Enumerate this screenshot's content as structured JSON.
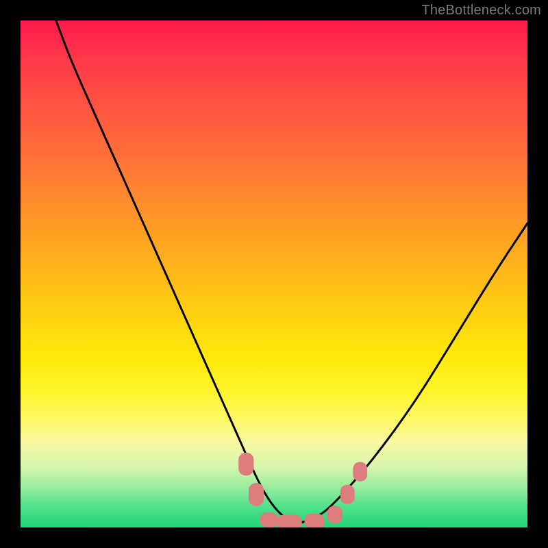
{
  "watermark": "TheBottleneck.com",
  "chart_data": {
    "type": "line",
    "title": "",
    "xlabel": "",
    "ylabel": "",
    "xlim": [
      0,
      100
    ],
    "ylim": [
      0,
      100
    ],
    "grid": false,
    "legend": false,
    "background_gradient": {
      "top": "#ff1a4d",
      "mid": "#ffe80a",
      "bottom": "#22d47a"
    },
    "series": [
      {
        "name": "bottleneck-curve",
        "color": "#000000",
        "x": [
          7,
          10,
          14,
          18,
          22,
          26,
          30,
          34,
          38,
          42,
          46,
          48,
          50,
          52,
          54,
          56,
          58,
          60,
          64,
          70,
          78,
          86,
          94,
          100
        ],
        "y": [
          100,
          92,
          83,
          74,
          65,
          56,
          47,
          38,
          29,
          20,
          11,
          7,
          4,
          2,
          1,
          1,
          2,
          3,
          7,
          14,
          25,
          38,
          51,
          60
        ]
      }
    ],
    "markers": {
      "name": "highlight-points",
      "shape": "rounded-rect",
      "color": "#de7d7d",
      "points": [
        {
          "x": 44.5,
          "y": 12.5,
          "w": 3.0,
          "h": 4.5
        },
        {
          "x": 46.5,
          "y": 6.5,
          "w": 3.0,
          "h": 4.5
        },
        {
          "x": 49.0,
          "y": 1.5,
          "w": 3.5,
          "h": 3.0
        },
        {
          "x": 53.0,
          "y": 1.0,
          "w": 5.0,
          "h": 3.0
        },
        {
          "x": 58.0,
          "y": 1.2,
          "w": 4.0,
          "h": 3.0
        },
        {
          "x": 62.0,
          "y": 2.5,
          "w": 3.0,
          "h": 3.5
        },
        {
          "x": 64.5,
          "y": 6.5,
          "w": 2.8,
          "h": 3.8
        },
        {
          "x": 67.0,
          "y": 11.0,
          "w": 2.8,
          "h": 3.8
        }
      ]
    }
  }
}
